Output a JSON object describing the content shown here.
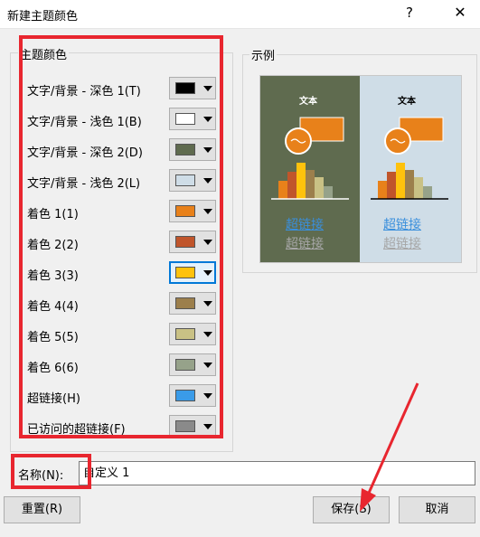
{
  "window": {
    "title": "新建主题颜色",
    "help_glyph": "?",
    "close_glyph": "✕"
  },
  "theme_colors": {
    "group_title": "主题颜色",
    "rows": [
      {
        "label": "文字/背景 - 深色 1(T)",
        "color": "#000000"
      },
      {
        "label": "文字/背景 - 浅色 1(B)",
        "color": "#ffffff"
      },
      {
        "label": "文字/背景 - 深色 2(D)",
        "color": "#5f6b4f"
      },
      {
        "label": "文字/背景 - 浅色 2(L)",
        "color": "#cfdde7"
      },
      {
        "label": "着色 1(1)",
        "color": "#e8811a"
      },
      {
        "label": "着色 2(2)",
        "color": "#c0552b"
      },
      {
        "label": "着色 3(3)",
        "color": "#fec20d"
      },
      {
        "label": "着色 4(4)",
        "color": "#9c7f4c"
      },
      {
        "label": "着色 5(5)",
        "color": "#c9c185"
      },
      {
        "label": "着色 6(6)",
        "color": "#96a28a"
      },
      {
        "label": "超链接(H)",
        "color": "#3a9be8"
      },
      {
        "label": "已访问的超链接(F)",
        "color": "#8a8a8a"
      }
    ],
    "selected_index": 6
  },
  "preview": {
    "group_title": "示例",
    "word": "文本",
    "link": "超链接",
    "visited_link": "超链接"
  },
  "name_field": {
    "label": "名称(N):",
    "value": "自定义 1"
  },
  "buttons": {
    "reset": "重置(R)",
    "save": "保存(S)",
    "cancel": "取消"
  },
  "colors": {
    "annotation_red": "#e8262f",
    "selection_blue": "#0078d7"
  }
}
